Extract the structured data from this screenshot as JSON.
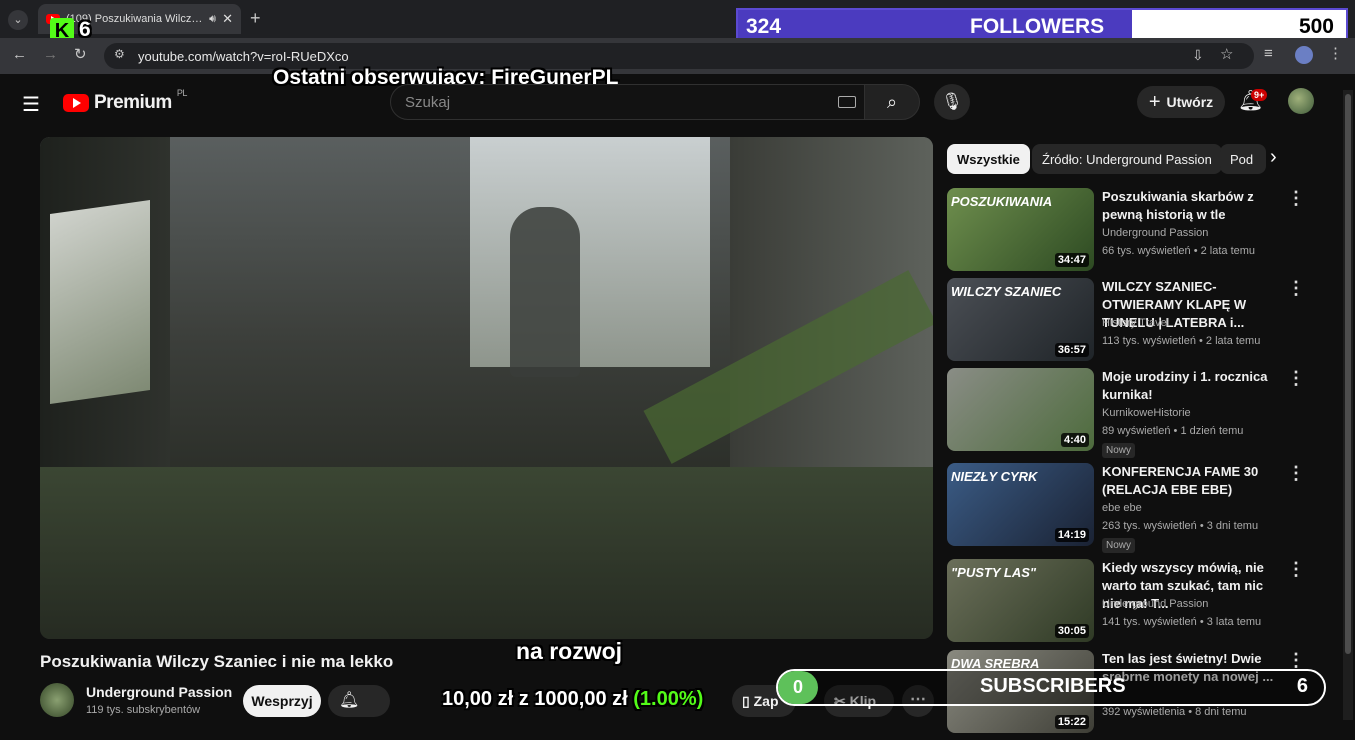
{
  "browser": {
    "tab_title": "(109) Poszukiwania Wilczy S",
    "url": "youtube.com/watch?v=roI-RUeDXco"
  },
  "overlay": {
    "kick_count": "6",
    "followers_current": "324",
    "followers_label": "FOLLOWERS",
    "followers_goal": "500",
    "followers_progress": 0.648,
    "last_follower": "Ostatni obserwujący: FireGunerPL",
    "caption": "na rozwoj",
    "donation_text": "10,00 zł z 1000,00 zł",
    "donation_percent": "(1.00%)",
    "subscribers_count_left": "0",
    "subscribers_label": "SUBSCRIBERS",
    "subscribers_count_right": "6"
  },
  "header": {
    "brand": "Premium",
    "region": "PL",
    "search_placeholder": "Szukaj",
    "create_label": "Utwórz",
    "notif_badge": "9+"
  },
  "chips": [
    "Wszystkie",
    "Źródło: Underground Passion",
    "Pod"
  ],
  "recommendations": [
    {
      "title": "Poszukiwania skarbów z pewną historią w tle",
      "channel": "Underground Passion",
      "meta": "66 tys. wyświetleń • 2 lata temu",
      "duration": "34:47",
      "thumb_text": "POSZUKIWANIA",
      "new": ""
    },
    {
      "title": "WILCZY SZANIEC-OTWIERAMY KLAPĘ W TUNELU | LATEBRA i...",
      "channel": "History Travel",
      "meta": "113 tys. wyświetleń • 2 lata temu",
      "duration": "36:57",
      "thumb_text": "WILCZY SZANIEC",
      "new": ""
    },
    {
      "title": "Moje urodziny i 1. rocznica kurnika!",
      "channel": "KurnikoweHistorie",
      "meta": "89 wyświetleń • 1 dzień temu",
      "duration": "4:40",
      "thumb_text": "",
      "new": "Nowy"
    },
    {
      "title": "KONFERENCJA FAME 30 (RELACJA EBE EBE)",
      "channel": "ebe ebe",
      "meta": "263 tys. wyświetleń • 3 dni temu",
      "duration": "14:19",
      "thumb_text": "NIEZŁY CYRK",
      "new": "Nowy"
    },
    {
      "title": "Kiedy wszyscy mówią, nie warto tam szukać, tam nic nie ma! T...",
      "channel": "Underground Passion",
      "meta": "141 tys. wyświetleń • 3 lata temu",
      "duration": "30:05",
      "thumb_text": "\"PUSTY LAS\"",
      "new": ""
    },
    {
      "title": "Ten las jest świetny! Dwie srebrne monety na nowej ...",
      "channel": "",
      "meta": "392 wyświetlenia • 8 dni temu",
      "duration": "15:22",
      "thumb_text": "DWA SREBRA",
      "new": ""
    }
  ],
  "video": {
    "title": "Poszukiwania Wilczy Szaniec i nie ma lekko",
    "channel": "Underground Passion",
    "subscribers": "119 tys. subskrybentów",
    "support_label": "Wesprzyj",
    "clip_label": "Klip",
    "save_label": "Zap"
  }
}
